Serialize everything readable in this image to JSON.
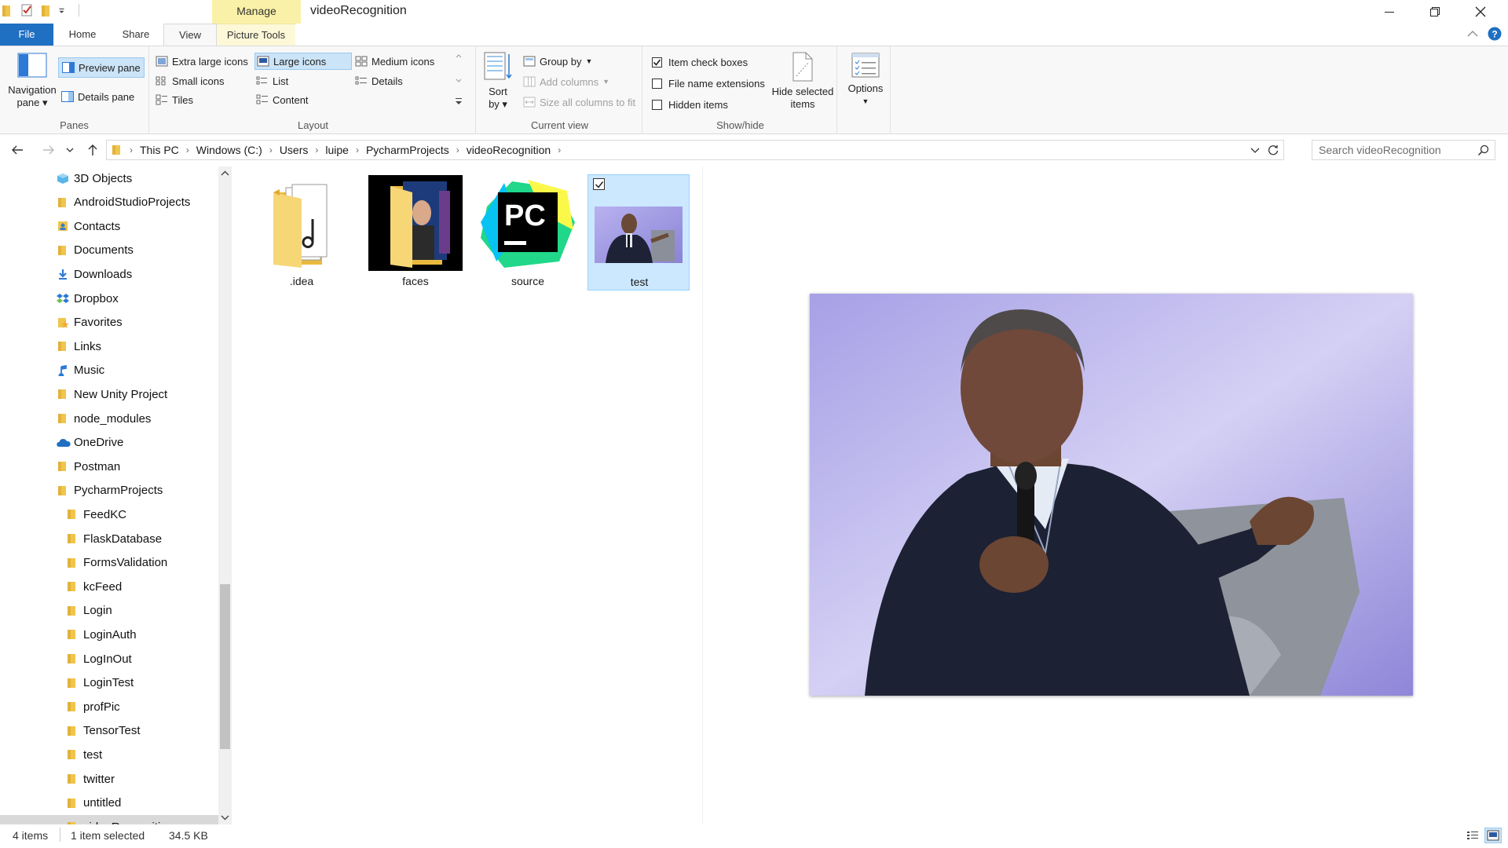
{
  "window": {
    "title": "videoRecognition",
    "contextual_tab_group": "Manage"
  },
  "ribbon_tabs": {
    "file": "File",
    "home": "Home",
    "share": "Share",
    "view": "View",
    "picture_tools": "Picture Tools"
  },
  "panes": {
    "label": "Panes",
    "navigation_pane": "Navigation",
    "navigation_pane_line2": "pane",
    "preview_pane": "Preview pane",
    "details_pane": "Details pane"
  },
  "layout": {
    "label": "Layout",
    "options": [
      "Extra large icons",
      "Large icons",
      "Medium icons",
      "Small icons",
      "List",
      "Details",
      "Tiles",
      "Content"
    ],
    "selected": "Large icons"
  },
  "current_view": {
    "label": "Current view",
    "sort_by": "Sort",
    "sort_by_line2": "by",
    "group_by": "Group by",
    "add_columns": "Add columns",
    "size_columns": "Size all columns to fit"
  },
  "show_hide": {
    "label": "Show/hide",
    "item_check_boxes": "Item check boxes",
    "item_check_boxes_checked": true,
    "file_name_extensions": "File name extensions",
    "file_name_extensions_checked": false,
    "hidden_items": "Hidden items",
    "hidden_items_checked": false,
    "hide_selected": "Hide selected",
    "hide_selected_line2": "items"
  },
  "options": {
    "label": "Options"
  },
  "address": {
    "crumbs": [
      "This PC",
      "Windows (C:)",
      "Users",
      "luipe",
      "PycharmProjects",
      "videoRecognition"
    ]
  },
  "search": {
    "placeholder": "Search videoRecognition"
  },
  "nav_tree": [
    {
      "label": "3D Objects",
      "icon": "3d-objects-icon",
      "indent": 0
    },
    {
      "label": "AndroidStudioProjects",
      "icon": "folder-icon",
      "indent": 0
    },
    {
      "label": "Contacts",
      "icon": "contacts-icon",
      "indent": 0
    },
    {
      "label": "Documents",
      "icon": "folder-icon",
      "indent": 0
    },
    {
      "label": "Downloads",
      "icon": "downloads-icon",
      "indent": 0
    },
    {
      "label": "Dropbox",
      "icon": "dropbox-icon",
      "indent": 0
    },
    {
      "label": "Favorites",
      "icon": "favorites-icon",
      "indent": 0
    },
    {
      "label": "Links",
      "icon": "folder-icon",
      "indent": 0
    },
    {
      "label": "Music",
      "icon": "music-icon",
      "indent": 0
    },
    {
      "label": "New Unity Project",
      "icon": "folder-icon",
      "indent": 0
    },
    {
      "label": "node_modules",
      "icon": "folder-icon",
      "indent": 0
    },
    {
      "label": "OneDrive",
      "icon": "onedrive-icon",
      "indent": 0
    },
    {
      "label": "Postman",
      "icon": "folder-icon",
      "indent": 0
    },
    {
      "label": "PycharmProjects",
      "icon": "folder-icon",
      "indent": 0
    },
    {
      "label": "FeedKC",
      "icon": "folder-icon",
      "indent": 1
    },
    {
      "label": "FlaskDatabase",
      "icon": "folder-icon",
      "indent": 1
    },
    {
      "label": "FormsValidation",
      "icon": "folder-icon",
      "indent": 1
    },
    {
      "label": "kcFeed",
      "icon": "folder-icon",
      "indent": 1
    },
    {
      "label": "Login",
      "icon": "folder-icon",
      "indent": 1
    },
    {
      "label": "LoginAuth",
      "icon": "folder-icon",
      "indent": 1
    },
    {
      "label": "LogInOut",
      "icon": "folder-icon",
      "indent": 1
    },
    {
      "label": "LoginTest",
      "icon": "folder-icon",
      "indent": 1
    },
    {
      "label": "profPic",
      "icon": "folder-icon",
      "indent": 1
    },
    {
      "label": "TensorTest",
      "icon": "folder-icon",
      "indent": 1
    },
    {
      "label": "test",
      "icon": "folder-icon",
      "indent": 1
    },
    {
      "label": "twitter",
      "icon": "folder-icon",
      "indent": 1
    },
    {
      "label": "untitled",
      "icon": "folder-icon",
      "indent": 1
    },
    {
      "label": "videoRecognition",
      "icon": "folder-icon",
      "indent": 1,
      "selected": true
    }
  ],
  "files": [
    {
      "name": ".idea",
      "kind": "folder-with-docs"
    },
    {
      "name": "faces",
      "kind": "folder-with-photo"
    },
    {
      "name": "source",
      "kind": "pycharm-file"
    },
    {
      "name": "test",
      "kind": "image-thumbnail",
      "selected": true
    }
  ],
  "status": {
    "items_count": "4 items",
    "selection": "1 item selected",
    "size": "34.5 KB"
  },
  "colors": {
    "accent": "#1f6fc2",
    "selection": "#cce8ff",
    "folder_yellow": "#f8d775",
    "manage_tab": "#faf1a8"
  }
}
